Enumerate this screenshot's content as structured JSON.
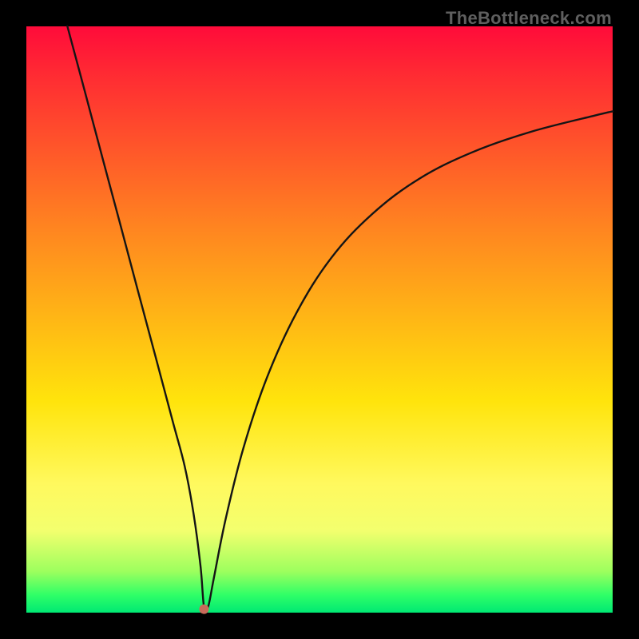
{
  "watermark": "TheBottleneck.com",
  "colors": {
    "frame": "#000000",
    "curve_stroke": "#151515",
    "dot_fill": "#c96a5a",
    "gradient_top": "#ff0b3a",
    "gradient_bottom": "#00e873"
  },
  "chart_data": {
    "type": "line",
    "title": "",
    "xlabel": "",
    "ylabel": "",
    "xlim": [
      0,
      100
    ],
    "ylim": [
      0,
      100
    ],
    "series": [
      {
        "name": "bottleneck-curve",
        "x": [
          7.0,
          10,
          13,
          16,
          19,
          22,
          25,
          27,
          28.5,
          29.7,
          30.3,
          31,
          32,
          34,
          37,
          41,
          46,
          52,
          59,
          67,
          76,
          86,
          97,
          100
        ],
        "y": [
          100,
          88.8,
          77.5,
          66.3,
          55.0,
          43.8,
          32.5,
          25.0,
          17.0,
          8.0,
          1.0,
          1.0,
          6.0,
          16.0,
          28.0,
          40.0,
          51.0,
          60.5,
          68.0,
          74.0,
          78.5,
          82.0,
          84.8,
          85.5
        ]
      }
    ],
    "annotations": [
      {
        "name": "min-dot",
        "x": 30.3,
        "y": 0.6
      }
    ]
  }
}
